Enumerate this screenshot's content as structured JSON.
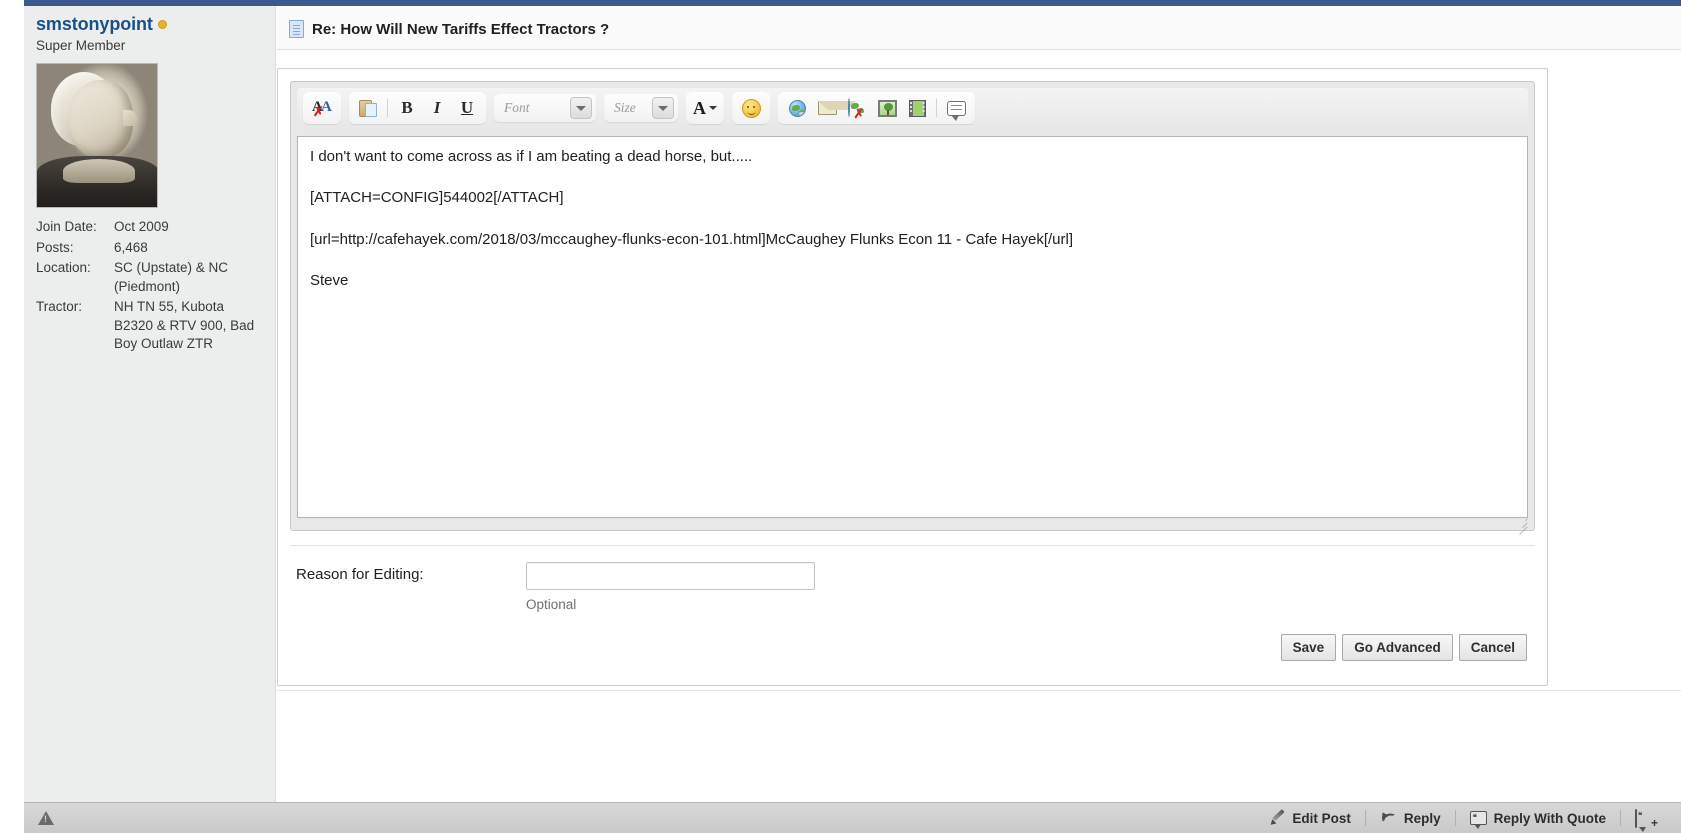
{
  "sidebar": {
    "username": "smstonypoint",
    "online_status_icon": "online-dot",
    "usertitle": "Super Member",
    "avatar_alt": "user-avatar-portrait",
    "info": [
      {
        "label": "Join Date:",
        "value": "Oct 2009"
      },
      {
        "label": "Posts:",
        "value": "6,468"
      },
      {
        "label": "Location:",
        "value": "SC (Upstate) & NC (Piedmont)"
      },
      {
        "label": "Tractor:",
        "value": "NH TN 55, Kubota B2320 & RTV 900, Bad Boy Outlaw ZTR"
      }
    ]
  },
  "header": {
    "icon": "document-icon",
    "title": "Re: How Will New Tariffs Effect Tractors ?"
  },
  "editor": {
    "toolbar": [
      {
        "name": "remove-formatting-icon",
        "title": "Remove Text Formatting"
      },
      {
        "name": "paste-icon",
        "title": "Paste"
      },
      {
        "name": "bold-icon",
        "title": "Bold",
        "glyph": "B"
      },
      {
        "name": "italic-icon",
        "title": "Italic",
        "glyph": "I"
      },
      {
        "name": "underline-icon",
        "title": "Underline",
        "glyph": "U"
      },
      {
        "name": "font-family-select",
        "title": "Font"
      },
      {
        "name": "font-size-select",
        "title": "Size"
      },
      {
        "name": "font-color-icon",
        "title": "Font Color",
        "glyph": "A"
      },
      {
        "name": "smilie-icon",
        "title": "Insert Smilie"
      },
      {
        "name": "insert-link-icon",
        "title": "Insert Link"
      },
      {
        "name": "insert-email-icon",
        "title": "Insert Email Link"
      },
      {
        "name": "remove-link-icon",
        "title": "Remove Link"
      },
      {
        "name": "insert-image-icon",
        "title": "Insert Image"
      },
      {
        "name": "insert-video-icon",
        "title": "Insert Video"
      },
      {
        "name": "wrap-quote-icon",
        "title": "Wrap [QUOTE] tags around selected text"
      }
    ],
    "font_select_label": "Font",
    "size_select_label": "Size",
    "body_lines": [
      "I don't want to come across as if I am beating a dead horse, but.....",
      "[ATTACH=CONFIG]544002[/ATTACH]",
      "[url=http://cafehayek.com/2018/03/mccaughey-flunks-econ-101.html]McCaughey Flunks Econ 11 - Cafe Hayek[/url]",
      "Steve"
    ]
  },
  "form": {
    "reason_label": "Reason for Editing:",
    "reason_value": "",
    "reason_placeholder": "",
    "optional_hint": "Optional",
    "buttons": {
      "save": "Save",
      "go_advanced": "Go Advanced",
      "cancel": "Cancel"
    }
  },
  "footer": {
    "report_icon": "warning-triangle-icon",
    "actions": [
      {
        "name": "edit-post",
        "icon": "pencil-icon",
        "label": "Edit Post"
      },
      {
        "name": "reply",
        "icon": "reply-arrow-icon",
        "label": "Reply"
      },
      {
        "name": "reply-with-quote",
        "icon": "quote-bubble-icon",
        "label": "Reply With Quote"
      },
      {
        "name": "multi-quote",
        "icon": "multi-quote-icon",
        "label": ""
      }
    ]
  },
  "colors": {
    "brand_blue": "#3c5a8f",
    "username_blue": "#1a4f8c",
    "sidebar_bg": "#eceded",
    "footer_bg": "#d0d0d0"
  }
}
